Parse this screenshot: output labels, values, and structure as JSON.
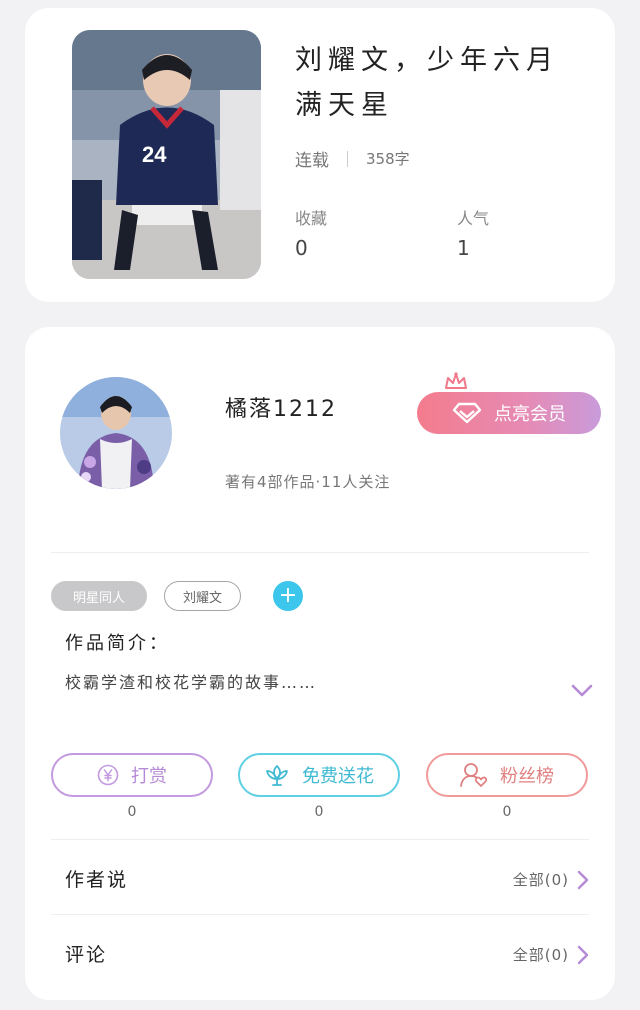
{
  "book": {
    "title": "刘耀文，少年六月满天星",
    "status": "连载",
    "word_count": "358字",
    "favorites_label": "收藏",
    "favorites_value": "0",
    "popularity_label": "人气",
    "popularity_value": "1"
  },
  "author": {
    "name": "橘落1212",
    "stats": "著有4部作品·11人关注",
    "vip_button": "点亮会员"
  },
  "tags": [
    "明星同人",
    "刘耀文"
  ],
  "add_tag": "+",
  "intro": {
    "title": "作品简介：",
    "text": "校霸学渣和校花学霸的故事……"
  },
  "actions": [
    {
      "label": "打赏",
      "count": "0",
      "icon": "yen-icon"
    },
    {
      "label": "免费送花",
      "count": "0",
      "icon": "flower-icon"
    },
    {
      "label": "粉丝榜",
      "count": "0",
      "icon": "fan-heart-icon"
    }
  ],
  "sections": [
    {
      "title": "作者说",
      "more": "全部(0)"
    },
    {
      "title": "评论",
      "more": "全部(0)"
    }
  ],
  "colors": {
    "background": "#f2f2f4",
    "card": "#ffffff",
    "vip_gradient_start": "#f47c8d",
    "vip_gradient_end": "#c99bdb",
    "reward": "#c39ae0",
    "flower": "#5fd0e4",
    "fans": "#f09a9a",
    "chevron": "#b58ad6",
    "add_tag": "#3cc6ec"
  }
}
